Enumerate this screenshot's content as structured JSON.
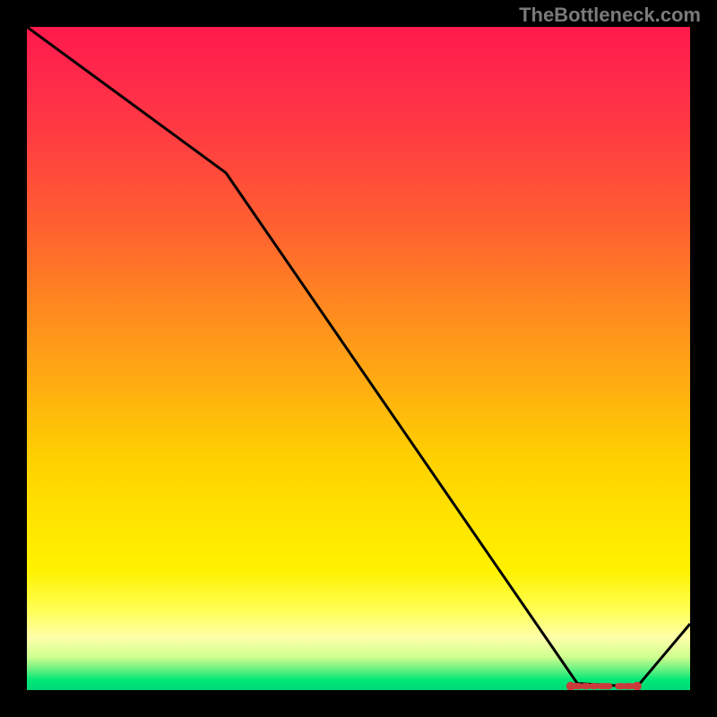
{
  "attribution": "TheBottleneck.com",
  "chart_data": {
    "type": "line",
    "title": "",
    "xlabel": "",
    "ylabel": "",
    "xlim": [
      0,
      100
    ],
    "ylim": [
      0,
      100
    ],
    "x": [
      0,
      30,
      83,
      92,
      100
    ],
    "values": [
      100,
      78,
      1,
      0.5,
      10
    ],
    "markers": {
      "x_start": 82,
      "x_end": 92,
      "y": 0.6,
      "color": "#cc3b3b"
    },
    "gradient_stops": [
      {
        "pos": 0,
        "color": "#ff1a4d"
      },
      {
        "pos": 50,
        "color": "#ffc000"
      },
      {
        "pos": 88,
        "color": "#ffff66"
      },
      {
        "pos": 100,
        "color": "#00d878"
      }
    ]
  }
}
